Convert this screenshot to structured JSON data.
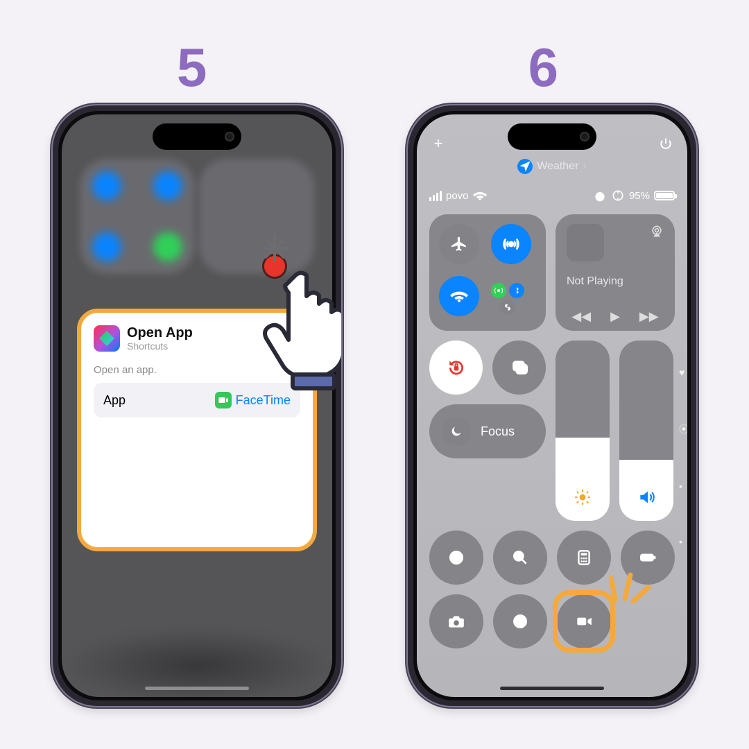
{
  "steps": {
    "left": "5",
    "right": "6"
  },
  "left": {
    "card": {
      "title": "Open App",
      "subtitle": "Shortcuts",
      "description": "Open an app.",
      "row_key": "App",
      "row_value": "FaceTime"
    }
  },
  "right": {
    "add_label": "+",
    "app_pill": "Weather",
    "app_pill_chevron": "›",
    "status": {
      "carrier": "povo",
      "battery_pct": "95%"
    },
    "music": {
      "state": "Not Playing"
    },
    "focus_label": "Focus",
    "icons": {
      "airplane": "airplane-icon",
      "airdrop": "airdrop-icon",
      "wifi": "wifi-icon",
      "cellular": "cellular-icon",
      "bluetooth": "bluetooth-icon",
      "link": "personal-hotspot-icon",
      "airplay": "airplay-icon",
      "lock": "orientation-lock-icon",
      "mirror": "screen-mirroring-icon",
      "moon": "moon-icon",
      "sun": "brightness-icon",
      "speaker": "volume-icon",
      "record": "screen-record-icon",
      "magnifier": "magnifier-icon",
      "calculator": "calculator-icon",
      "lowpower": "low-power-icon",
      "camera": "camera-icon",
      "darkmode": "dark-mode-icon",
      "video": "video-camera-icon",
      "heart": "heart-icon",
      "hearing": "hearing-icon",
      "power": "power-icon",
      "location": "location-icon"
    }
  }
}
